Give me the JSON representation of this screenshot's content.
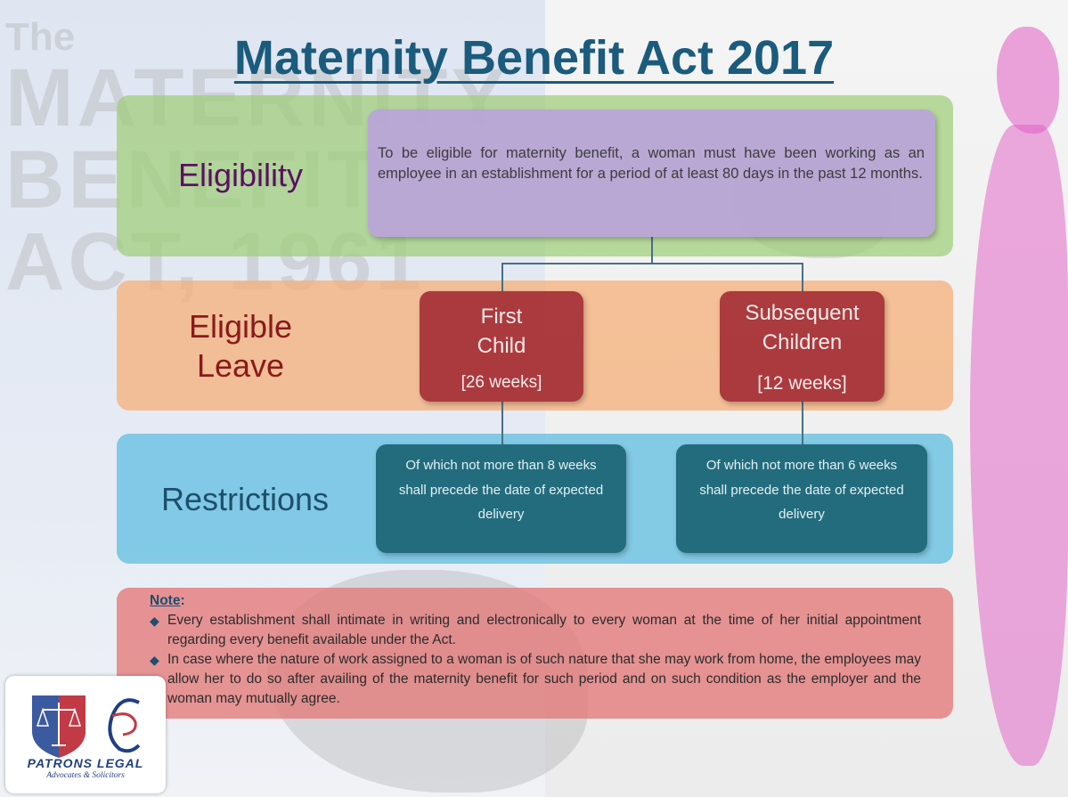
{
  "title": "Maternity Benefit Act 2017",
  "watermark": {
    "line1": "The",
    "line2": "MATERNITY",
    "line3": "BENEFIT",
    "line4": "ACT, 1961"
  },
  "rows": {
    "eligibility": {
      "label": "Eligibility",
      "text": "To be eligible for maternity benefit, a woman must have been working as an employee in an establishment for a period of at least 80 days in the past 12 months."
    },
    "eligible_leave": {
      "label_line1": "Eligible",
      "label_line2": "Leave",
      "first": {
        "line1": "First",
        "line2": "Child",
        "weeks": "[26 weeks]"
      },
      "subsequent": {
        "line1": "Subsequent",
        "line2": "Children",
        "weeks": "[12 weeks]"
      }
    },
    "restrictions": {
      "label": "Restrictions",
      "first": "Of which not more than 8 weeks shall precede the date of expected delivery",
      "subsequent": "Of which not more than 6 weeks shall precede the date of expected delivery"
    }
  },
  "note": {
    "title": "Note",
    "colon": ":",
    "bullets": [
      "Every establishment shall intimate in writing and electronically to every woman at the time of her initial appointment regarding every benefit available under the Act.",
      "In case where the nature of work assigned to a woman is of such nature that she may work from home, the employees may allow her to do so after availing of the maternity benefit for such period and on such condition as the employer and the woman may mutually agree."
    ]
  },
  "logo": {
    "name": "PATRONS LEGAL",
    "tagline": "Advocates & Solicitors"
  },
  "colors": {
    "title": "#1b5b7d",
    "eligibility_band": "#a0cd78",
    "leave_band": "#f5af78",
    "restrictions_band": "#5fbee1",
    "note_band": "#e47878",
    "leave_box": "#a02832",
    "restriction_box": "#145f6e",
    "eligibility_box": "#b9a0dc"
  }
}
